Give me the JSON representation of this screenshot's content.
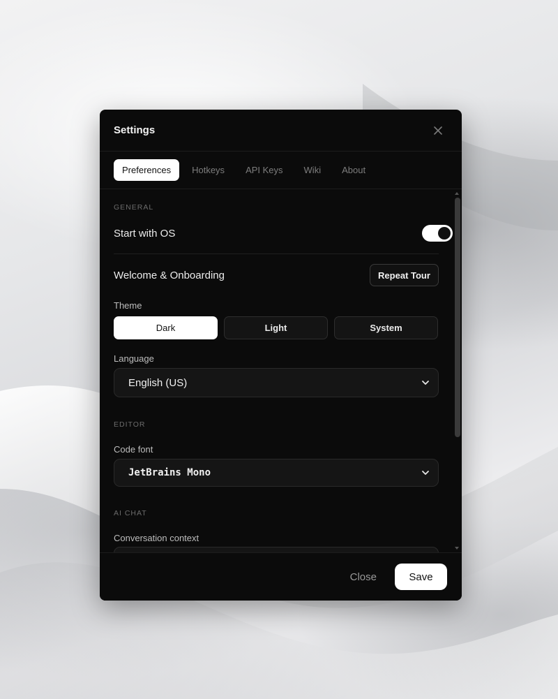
{
  "dialog": {
    "title": "Settings",
    "close_icon": "close-icon"
  },
  "tabs": [
    {
      "label": "Preferences",
      "active": true
    },
    {
      "label": "Hotkeys",
      "active": false
    },
    {
      "label": "API Keys",
      "active": false
    },
    {
      "label": "Wiki",
      "active": false
    },
    {
      "label": "About",
      "active": false
    }
  ],
  "general": {
    "section_label": "GENERAL",
    "start_with_os": {
      "label": "Start with OS",
      "enabled": true
    },
    "onboarding": {
      "label": "Welcome & Onboarding",
      "button_label": "Repeat Tour"
    },
    "theme": {
      "label": "Theme",
      "options": [
        "Dark",
        "Light",
        "System"
      ],
      "selected": "Dark"
    },
    "language": {
      "label": "Language",
      "value": "English (US)"
    }
  },
  "editor": {
    "section_label": "EDITOR",
    "code_font": {
      "label": "Code font",
      "value": "JetBrains Mono"
    }
  },
  "ai_chat": {
    "section_label": "AI CHAT",
    "conversation_context": {
      "label": "Conversation context"
    }
  },
  "footer": {
    "close_label": "Close",
    "save_label": "Save"
  },
  "colors": {
    "dialog_bg": "#0b0b0b",
    "accent": "#ffffff",
    "muted_text": "#7d7d7d"
  }
}
